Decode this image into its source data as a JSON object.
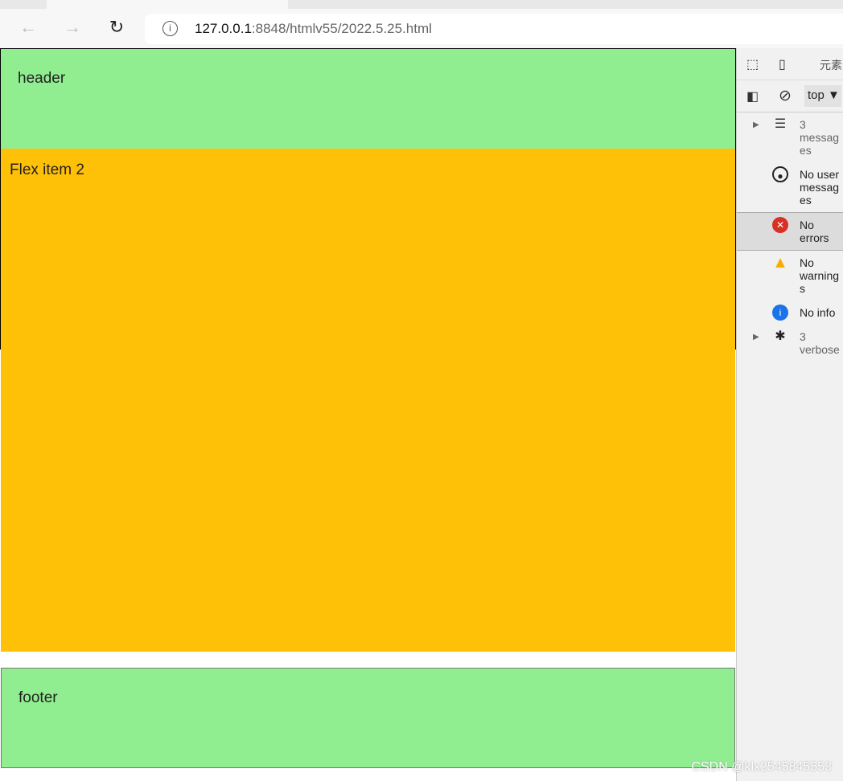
{
  "browser": {
    "url_host": "127.0.0.1",
    "url_rest": ":8848/htmlv55/2022.5.25.html"
  },
  "page": {
    "header": "header",
    "item2": "Flex item 2",
    "footer": "footer"
  },
  "devtools": {
    "tab_elements": "元素",
    "context": "top",
    "messages": [
      {
        "text": "3 messages",
        "icon": "list-icon"
      },
      {
        "text": "No user messages",
        "icon": "user-icon"
      },
      {
        "text": "No errors",
        "icon": "error-icon"
      },
      {
        "text": "No warnings",
        "icon": "warning-icon"
      },
      {
        "text": "No info",
        "icon": "info-icon"
      },
      {
        "text": "3 verbose",
        "icon": "bug-icon"
      }
    ]
  },
  "watermark": "CSDN @klx2545845553",
  "colors": {
    "green": "#90ee90",
    "orange": "#ffc107",
    "error": "#d93025",
    "warning": "#f9ab00",
    "info": "#1a73e8"
  }
}
